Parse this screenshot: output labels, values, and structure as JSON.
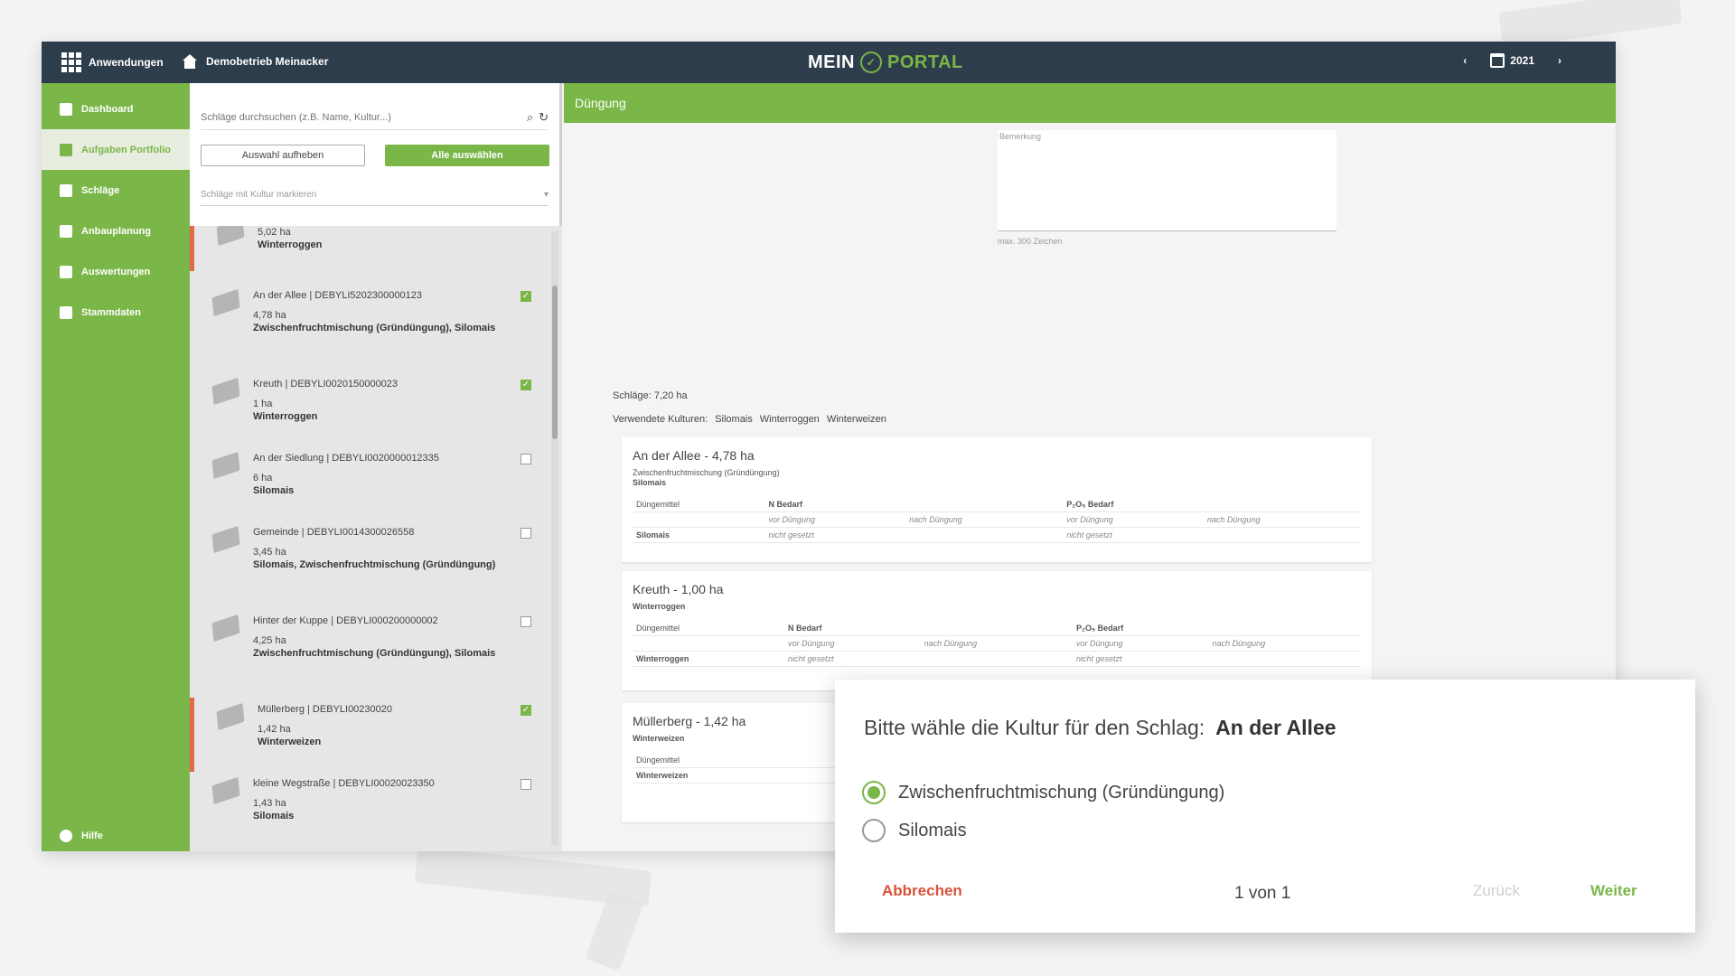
{
  "topbar": {
    "apps_label": "Anwendungen",
    "farm_label": "Demobetrieb Meinacker",
    "logo_mein": "MEIN",
    "logo_portal": "PORTAL",
    "year": "2021"
  },
  "sidebar": {
    "items": [
      {
        "label": "Dashboard"
      },
      {
        "label": "Aufgaben Portfolio"
      },
      {
        "label": "Schläge"
      },
      {
        "label": "Anbauplanung"
      },
      {
        "label": "Auswertungen"
      },
      {
        "label": "Stammdaten"
      }
    ],
    "help": "Hilfe"
  },
  "list": {
    "search_placeholder": "Schläge durchsuchen (z.B. Name, Kultur...)",
    "btn_clear": "Auswahl aufheben",
    "btn_select_all": "Alle auswählen",
    "culture_select": "Schläge mit Kultur markieren",
    "items": [
      {
        "name": "",
        "area": "5,02 ha",
        "crop": "Winterroggen",
        "checked": false
      },
      {
        "name": "An der Allee | DEBYLI5202300000123",
        "area": "4,78 ha",
        "crop": "Zwischenfruchtmischung (Gründüngung), Silomais",
        "checked": true
      },
      {
        "name": "Kreuth | DEBYLI0020150000023",
        "area": "1 ha",
        "crop": "Winterroggen",
        "checked": true
      },
      {
        "name": "An der Siedlung | DEBYLI0020000012335",
        "area": "6 ha",
        "crop": "Silomais",
        "checked": false
      },
      {
        "name": "Gemeinde | DEBYLI0014300026558",
        "area": "3,45 ha",
        "crop": "Silomais, Zwischenfruchtmischung (Gründüngung)",
        "checked": false
      },
      {
        "name": "Hinter der Kuppe | DEBYLI000200000002",
        "area": "4,25 ha",
        "crop": "Zwischenfruchtmischung (Gründüngung), Silomais",
        "checked": false
      },
      {
        "name": "Müllerberg | DEBYLI00230020",
        "area": "1,42 ha",
        "crop": "Winterweizen",
        "checked": true
      },
      {
        "name": "kleine Wegstraße | DEBYLI00020023350",
        "area": "1,43 ha",
        "crop": "Silomais",
        "checked": false
      }
    ]
  },
  "content": {
    "header": "Düngung",
    "textarea_label": "Bemerkung",
    "char_hint": "max. 300 Zeichen",
    "fields_area": "Schläge: 7,20 ha",
    "cultures_label": "Verwendete Kulturen:",
    "cultures": [
      "Silomais",
      "Winterroggen",
      "Winterweizen"
    ],
    "table_headers": {
      "fertilizer": "Düngemittel",
      "n": "N Bedarf",
      "p": "P₂O₅ Bedarf",
      "before": "vor Düngung",
      "after": "nach Düngung",
      "not_set": "nicht gesetzt"
    },
    "cards": [
      {
        "title": "An der Allee - 4,78  ha",
        "sub1": "Zwischenfruchtmischung (Gründüngung)",
        "sub2": "Silomais",
        "row": "Silomais"
      },
      {
        "title": "Kreuth - 1,00  ha",
        "sub1": "Winterroggen",
        "sub2": "",
        "row": "Winterroggen"
      },
      {
        "title": "Müllerberg - 1,42  ha",
        "sub1": "Winterweizen",
        "sub2": "",
        "row": "Winterweizen"
      }
    ]
  },
  "dialog": {
    "question": "Bitte wähle die Kultur für den Schlag:",
    "field_name": "An der Allee",
    "options": [
      {
        "label": "Zwischenfruchtmischung (Gründüngung)",
        "selected": true
      },
      {
        "label": "Silomais",
        "selected": false
      }
    ],
    "cancel": "Abbrechen",
    "pager": "1 von 1",
    "back": "Zurück",
    "next": "Weiter"
  },
  "colors": {
    "brand_green": "#7ab648",
    "topbar_dark": "#2e3d4c",
    "cancel_red": "#d9533b"
  }
}
